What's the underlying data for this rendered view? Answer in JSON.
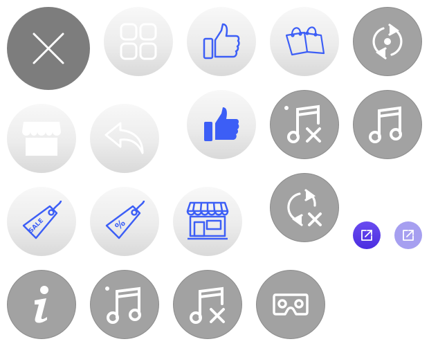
{
  "colors": {
    "light_button": "#eeeeee",
    "gray_button": "#a2a2a2",
    "dark_button": "#7d7d7d",
    "blue_icon": "#3c5ef6",
    "violet_button": "#5334e8",
    "lavender_button": "#a69ff0"
  },
  "buttons": [
    {
      "icon": "close-icon"
    },
    {
      "icon": "grid-icon"
    },
    {
      "icon": "thumbs-up-outline-icon"
    },
    {
      "icon": "shopping-bags-icon"
    },
    {
      "icon": "repeat-icon"
    },
    {
      "icon": "storefront-icon"
    },
    {
      "icon": "reply-icon"
    },
    {
      "icon": "thumbs-up-filled-icon"
    },
    {
      "icon": "music-remove-icon"
    },
    {
      "icon": "music-icon"
    },
    {
      "icon": "sale-tag-icon"
    },
    {
      "icon": "percent-tag-icon"
    },
    {
      "icon": "shop-icon"
    },
    {
      "icon": "repeat-off-icon"
    },
    {
      "icon": "share-icon"
    },
    {
      "icon": "share-icon"
    },
    {
      "icon": "info-icon"
    },
    {
      "icon": "music-add-icon"
    },
    {
      "icon": "music-remove-icon"
    },
    {
      "icon": "vr-headset-icon"
    }
  ],
  "tag_text": {
    "sale": "SALE",
    "percent": "%"
  }
}
